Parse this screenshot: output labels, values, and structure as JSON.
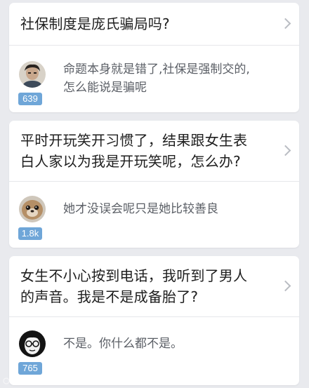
{
  "feed": {
    "items": [
      {
        "question": "社保制度是庞氏骗局吗?",
        "answer_line1": "命题本身就是错了,社保是强制交的,",
        "answer_line2": "怎么能说是骗呢",
        "votes": "639",
        "avatar": "portrait-avatar"
      },
      {
        "question_line1": "平时开玩笑开习惯了，结果跟女生表",
        "question_line2": "白人家以为我是开玩笑呢，怎么办?",
        "answer": "她才没误会呢只是她比较善良",
        "votes": "1.8k",
        "avatar": "seal-avatar"
      },
      {
        "question_line1": "女生不小心按到电话，我听到了男人",
        "question_line2": "的声音。我是不是成备胎了?",
        "answer": "不是。你什么都不是。",
        "votes": "765",
        "avatar": "glasses-avatar"
      }
    ]
  },
  "colors": {
    "background": "#e9eaee",
    "card": "#ffffff",
    "vote_badge": "#6fa6d8",
    "title_text": "#1e1e1e",
    "answer_text": "#5b5f66"
  }
}
